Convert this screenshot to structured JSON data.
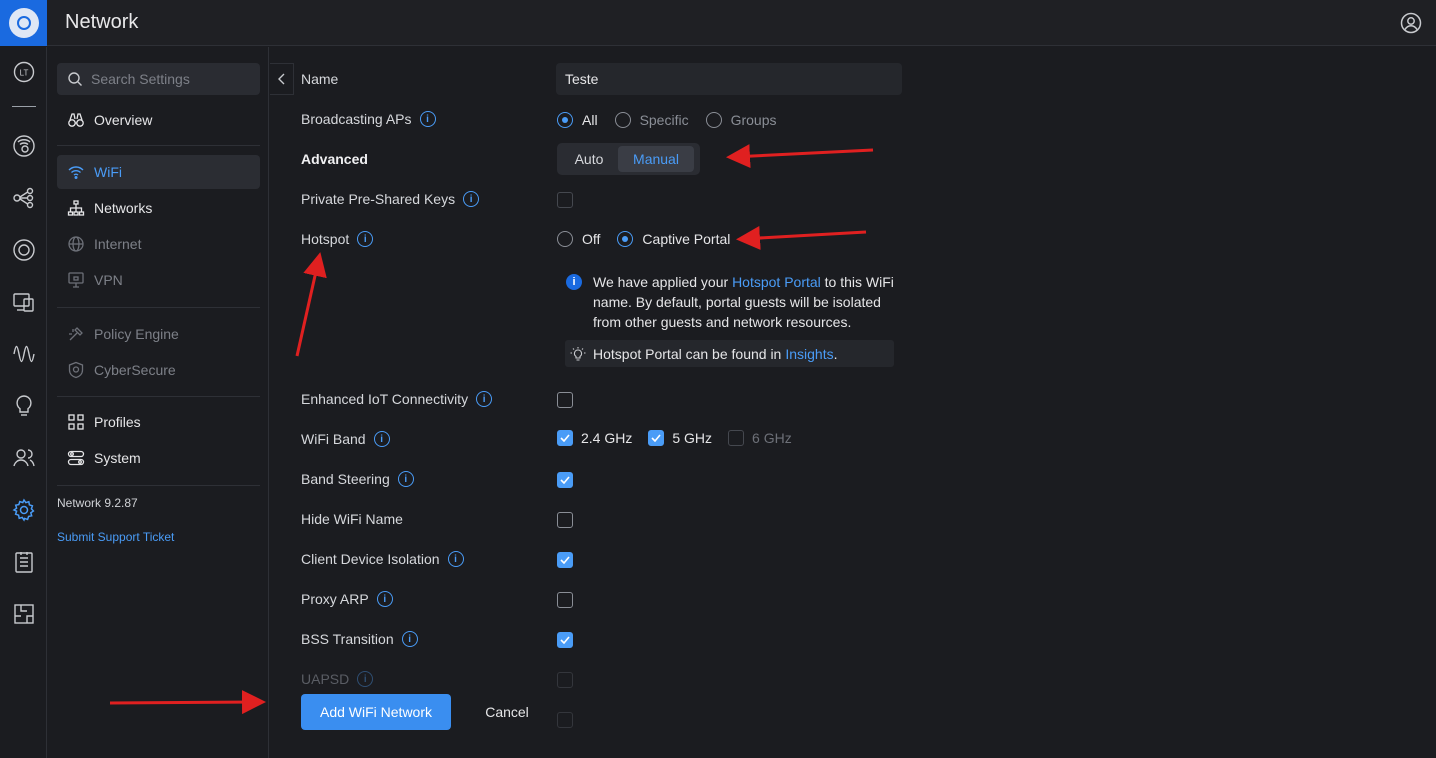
{
  "header": {
    "title": "Network"
  },
  "rail": {
    "top_label": "LT"
  },
  "sidebar": {
    "search_placeholder": "Search Settings",
    "items": [
      {
        "label": "Overview"
      },
      {
        "label": "WiFi"
      },
      {
        "label": "Networks"
      },
      {
        "label": "Internet"
      },
      {
        "label": "VPN"
      },
      {
        "label": "Policy Engine"
      },
      {
        "label": "CyberSecure"
      },
      {
        "label": "Profiles"
      },
      {
        "label": "System"
      }
    ],
    "version": "Network 9.2.87",
    "support_link": "Submit Support Ticket"
  },
  "form": {
    "name": {
      "label": "Name",
      "value": "Teste"
    },
    "broadcasting": {
      "label": "Broadcasting APs",
      "options": [
        "All",
        "Specific",
        "Groups"
      ],
      "selected": "All"
    },
    "advanced": {
      "label": "Advanced",
      "options": [
        "Auto",
        "Manual"
      ],
      "selected": "Manual"
    },
    "ppsk": {
      "label": "Private Pre-Shared Keys",
      "checked": false
    },
    "hotspot": {
      "label": "Hotspot",
      "options": [
        "Off",
        "Captive Portal"
      ],
      "selected": "Captive Portal",
      "notice_pre": "We have applied your ",
      "notice_link": "Hotspot Portal",
      "notice_post": " to this WiFi name. By default, portal guests will be isolated from other guests and network resources.",
      "tip_pre": "Hotspot Portal can be found in ",
      "tip_link": "Insights",
      "tip_post": "."
    },
    "iot": {
      "label": "Enhanced IoT Connectivity",
      "checked": false
    },
    "band": {
      "label": "WiFi Band",
      "options": [
        {
          "label": "2.4 GHz",
          "checked": true
        },
        {
          "label": "5 GHz",
          "checked": true
        },
        {
          "label": "6 GHz",
          "checked": false
        }
      ]
    },
    "band_steering": {
      "label": "Band Steering",
      "checked": true
    },
    "hide_name": {
      "label": "Hide WiFi Name",
      "checked": false
    },
    "client_isolation": {
      "label": "Client Device Isolation",
      "checked": true
    },
    "proxy_arp": {
      "label": "Proxy ARP",
      "checked": false
    },
    "bss_transition": {
      "label": "BSS Transition",
      "checked": true
    },
    "uapsd": {
      "label": "UAPSD",
      "checked": false
    }
  },
  "actions": {
    "primary": "Add WiFi Network",
    "cancel": "Cancel"
  },
  "colors": {
    "accent": "#4a9cf7",
    "primary_button": "#3a8ef0",
    "annotation_arrow": "#e02020"
  }
}
